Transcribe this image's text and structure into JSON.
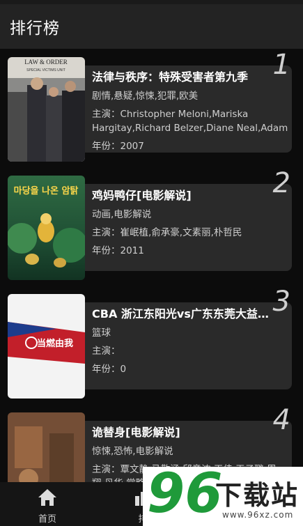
{
  "header": {
    "title": "排行榜"
  },
  "items": [
    {
      "rank": "1",
      "title": "法律与秩序：特殊受害者第九季",
      "genres": "剧情,悬疑,惊悚,犯罪,欧美",
      "cast": "主演：Christopher Meloni,Mariska Hargitay,Richard Belzer,Diane Neal,Adam …",
      "year": "年份：2007",
      "poster_caption": "LAW & ORDER",
      "poster_sub": "SPECIAL VICTIMS UNIT"
    },
    {
      "rank": "2",
      "title": "鸡妈鸭仔[电影解说]",
      "genres": "动画,电影解说",
      "cast": "主演：崔岷植,俞承豪,文素丽,朴哲民",
      "year": "年份：2011",
      "poster_caption": "마당을 나온 암탉"
    },
    {
      "rank": "3",
      "title": "CBA 浙江东阳光vs广东东莞大益…",
      "genres": "篮球",
      "cast": "主演：",
      "year": "年份：0",
      "poster_caption": "当燃由我"
    },
    {
      "rank": "4",
      "title": "诡替身[电影解说]",
      "genres": "惊悚,恐怖,电影解说",
      "cast": "主演：覃文静,马敬涵,邱意浓,王佳,王子璐,周翔,丹华,常略",
      "year": ""
    }
  ],
  "nav": [
    {
      "label": "首页",
      "icon": "home-icon"
    },
    {
      "label": "排",
      "icon": "rank-icon"
    }
  ],
  "watermark": {
    "number": "96",
    "text": "下载站",
    "url": "www.96xz.com"
  }
}
